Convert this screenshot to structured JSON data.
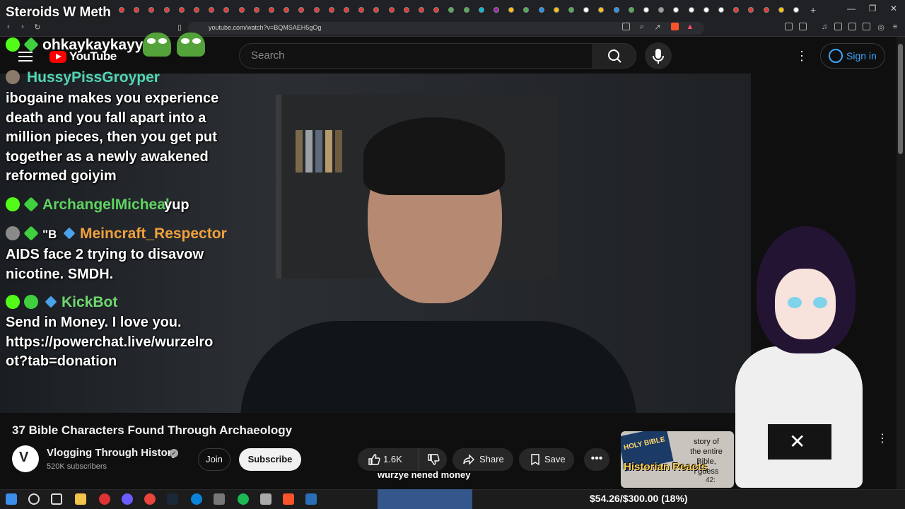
{
  "browser": {
    "url": "youtube.com/watch?v=BQMSAEH5gOg",
    "new_tab_label": "+",
    "window_controls": [
      "—",
      "❐",
      "✕"
    ]
  },
  "youtube": {
    "logo_text": "YouTube",
    "search_placeholder": "Search",
    "signin_label": "Sign in",
    "more_menu": "⋮"
  },
  "stream_overlay": {
    "title": "Steroids W Meth",
    "chat": [
      {
        "user": "ohkaykaykayy",
        "user_color": "#ffffff",
        "message": ""
      },
      {
        "user": "HussyPissGroyper",
        "user_color": "#53d6b4",
        "message_lines": [
          "ibogaine makes you experience",
          "death and you fall apart into a",
          "million pieces, then you get put",
          "together as a newly awakened",
          "reformed goiyim"
        ]
      },
      {
        "user": "ArchangelMicheal",
        "user_color": "#5fd35f",
        "message": "yup"
      },
      {
        "user": "Meincraft_Respector",
        "user_color": "#f0a13c",
        "badge_text": "\"B",
        "message_lines": [
          "AIDS face 2 trying to disavow",
          "nicotine. SMDH."
        ]
      },
      {
        "user": "KickBot",
        "user_color": "#6fd86f",
        "message_lines": [
          "Send in Money. I love you.",
          "https://powerchat.live/wurzelro",
          "ot?tab=donation"
        ]
      }
    ],
    "caption": "wurzye nened money",
    "donation_goal": "$54.26/$300.00 (18%)"
  },
  "video": {
    "title": "37 Bible Characters Found Through Archaeology",
    "channel_name": "Vlogging Through History",
    "subscribers": "520K subscribers",
    "join_label": "Join",
    "subscribe_label": "Subscribe",
    "like_count": "1.6K",
    "share_label": "Share",
    "save_label": "Save",
    "more_label": "•••"
  },
  "side_card": {
    "bible_text": "HOLY BIBLE",
    "text_lines": [
      "story of",
      "the entire",
      "Bible,",
      "i guess"
    ],
    "historian_reacts": "Historian Reacts",
    "duration": "42:",
    "overflow": "⋮"
  },
  "colors": {
    "yt_red": "#ff0000",
    "link_blue": "#3ea6ff",
    "background": "#0f0f0f"
  }
}
